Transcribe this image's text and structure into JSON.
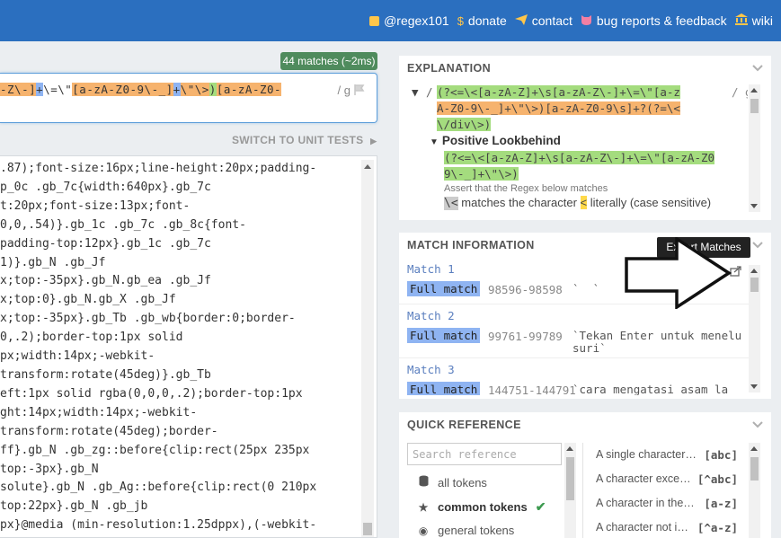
{
  "nav": [
    {
      "icon": "twitter-icon",
      "label": "@regex101"
    },
    {
      "icon": "dollar-icon",
      "label": "donate"
    },
    {
      "icon": "paper-plane-icon",
      "label": "contact"
    },
    {
      "icon": "github-icon",
      "label": "bug reports & feedback"
    },
    {
      "icon": "bank-icon",
      "label": "wiki"
    }
  ],
  "regex": {
    "match_badge": "44 matches (~2ms)",
    "tokens": [
      {
        "t": "-Z\\-]",
        "c": "or"
      },
      {
        "t": "+",
        "c": "bl"
      },
      {
        "t": "\\=\\\"",
        "c": ""
      },
      {
        "t": "[a-zA-Z0-9\\-_]",
        "c": "or"
      },
      {
        "t": "+",
        "c": "bl"
      },
      {
        "t": "\\\"\\>",
        "c": "or"
      },
      {
        "t": ")",
        "c": "gr"
      },
      {
        "t": "[a-zA-Z0-",
        "c": "or"
      }
    ],
    "flags": "/ g"
  },
  "switch_label": "SWITCH TO UNIT TESTS",
  "test_string_lines": [
    ".87);font-size:16px;line-height:20px;padding-",
    "p_0c .gb_7c{width:640px}.gb_7c",
    "t:20px;font-size:13px;font-",
    "0,0,.54)}.gb_1c .gb_7c .gb_8c{font-",
    "padding-top:12px}.gb_1c .gb_7c",
    "1)}.gb_N .gb_Jf",
    "x;top:-35px}.gb_N.gb_ea .gb_Jf",
    "x;top:0}.gb_N.gb_X .gb_Jf",
    "x;top:-35px}.gb_Tb .gb_wb{border:0;border-",
    "0,.2);border-top:1px solid",
    "px;width:14px;-webkit-",
    "transform:rotate(45deg)}.gb_Tb",
    "eft:1px solid rgba(0,0,0,.2);border-top:1px",
    "ght:14px;width:14px;-webkit-",
    "transform:rotate(45deg);border-",
    "ff}.gb_N .gb_zg::before{clip:rect(25px 235px",
    "top:-3px}.gb_N",
    "solute}.gb_N .gb_Ag::before{clip:rect(0 210px",
    "top:22px}.gb_N .gb_jb",
    "px}@media (min-resolution:1.25dppx),(-webkit-"
  ],
  "explanation": {
    "title": "EXPLANATION",
    "regex_line1": "(?<=\\<[a-zA-Z]+\\s[a-zA-Z\\-]+\\=\\\"[a-z",
    "regex_flags": "/ g",
    "regex_line2": "A-Z0-9\\-_]+\\\"\\>)[a-zA-Z0-9\\s]+?(?=\\<",
    "regex_line3": "\\/div\\>)",
    "lookbehind_title": "Positive Lookbehind",
    "lb_line1": "(?<=\\<[a-zA-Z]+\\s[a-zA-Z\\-]+\\=\\\"[a-zA-Z0",
    "lb_line2": "9\\-_]+\\\"\\>)",
    "assert_text": "Assert that the Regex below matches",
    "match_token": "\\<",
    "match_text_pre": "matches the character",
    "match_char": "<",
    "match_text_post": "literally (case sensitive)"
  },
  "match_info": {
    "title": "MATCH INFORMATION",
    "export_tooltip": "Export Matches",
    "matches": [
      {
        "label": "Match 1",
        "tag": "Full match",
        "range": "98596-98598",
        "value": "`  `"
      },
      {
        "label": "Match 2",
        "tag": "Full match",
        "range": "99761-99789",
        "value": "`Tekan Enter untuk menelu\nsuri`"
      },
      {
        "label": "Match 3",
        "tag": "Full match",
        "range": "144751-144791",
        "value": "`cara mengatasi asam la"
      }
    ]
  },
  "quick_reference": {
    "title": "QUICK REFERENCE",
    "search_placeholder": "Search reference",
    "categories": [
      {
        "icon": "database-icon",
        "label": "all tokens"
      },
      {
        "icon": "star-icon",
        "label": "common tokens",
        "active": true
      },
      {
        "icon": "circle-icon",
        "label": "general tokens"
      }
    ],
    "items": [
      {
        "desc": "A single character…",
        "token": "[abc]"
      },
      {
        "desc": "A character exce…",
        "token": "[^abc]"
      },
      {
        "desc": "A character in the…",
        "token": "[a-z]"
      },
      {
        "desc": "A character not i…",
        "token": "[^a-z]"
      }
    ]
  },
  "colors": {
    "topbar": "#2b6fbf",
    "accent_yellow": "#ffc64a",
    "match_badge": "#4f8b5d",
    "hl_orange": "#f6b36e",
    "hl_blue": "#8fb4f2",
    "hl_green": "#a4dc7e"
  }
}
